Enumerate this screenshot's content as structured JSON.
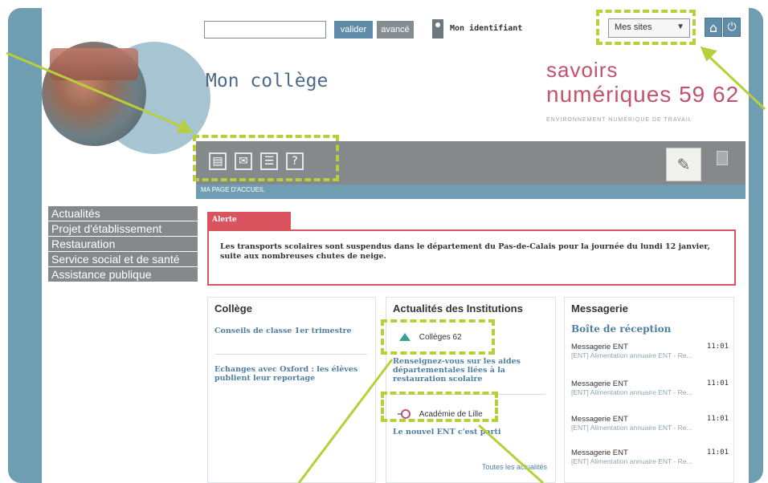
{
  "topbar": {
    "search_value": "",
    "valider_label": "valider",
    "avance_label": "avancé",
    "identifiant_label": "Mon identifiant",
    "sites_selected": "Mes sites"
  },
  "header": {
    "title": "Mon collège",
    "logo_line1": "savoirs",
    "logo_line2": "numériques 59 62",
    "logo_tagline": "ENVIRONNEMENT NUMÉRIQUE DE TRAVAIL"
  },
  "toolbar": {
    "sublabel": "MA PAGE D'ACCUEIL",
    "icons": [
      "news-icon",
      "mail-icon",
      "list-icon",
      "help-icon"
    ]
  },
  "left_menu": {
    "items": [
      "Actualités",
      "Projet d'établissement",
      "Restauration",
      "Service social et de santé",
      "Assistance publique"
    ]
  },
  "alert": {
    "tab_label": "Alerte",
    "text": "Les transports scolaires sont suspendus dans le département du Pas-de-Calais pour la journée du lundi 12 janvier, suite aux nombreuses chutes de neige."
  },
  "college_panel": {
    "title": "Collège",
    "links": [
      "Conseils de classe 1er trimestre",
      "Echanges avec Oxford : les élèves publient leur reportage"
    ]
  },
  "institutions_panel": {
    "title": "Actualités des Institutions",
    "items": [
      {
        "source": "Collèges 62",
        "headline": "Renseignez-vous sur les aides départementales liées à la restauration scolaire"
      },
      {
        "source": "Académie de Lille",
        "headline": "Le nouvel ENT c'est parti"
      }
    ],
    "all_news_label": "Toutes les actualités"
  },
  "messagerie_panel": {
    "title": "Messagerie",
    "inbox_title": "Boîte de réception",
    "messages": [
      {
        "sender": "Messagerie ENT",
        "time": "11:01",
        "subject": "[ENT] Alimentation annuaire ENT - Re..."
      },
      {
        "sender": "Messagerie ENT",
        "time": "11:01",
        "subject": "[ENT] Alimentation annuaire ENT - Re..."
      },
      {
        "sender": "Messagerie ENT",
        "time": "11:01",
        "subject": "[ENT] Alimentation annuaire ENT - Re..."
      },
      {
        "sender": "Messagerie ENT",
        "time": "11:01",
        "subject": "[ENT] Alimentation annuaire ENT - Re..."
      }
    ]
  },
  "colors": {
    "accent_blue": "#6f9db2",
    "toolbar_grey": "#85898c",
    "alert_red": "#d9545e",
    "logo_pink": "#c2526e",
    "highlight_green": "#b7cf3a"
  }
}
